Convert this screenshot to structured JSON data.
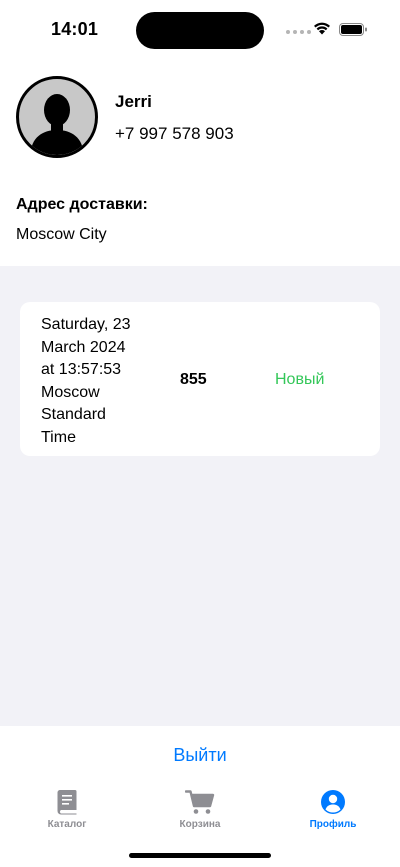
{
  "status_bar": {
    "time": "14:01"
  },
  "profile": {
    "name": "Jerri",
    "phone": "+7  997 578 903"
  },
  "delivery": {
    "label": "Адрес доставки:",
    "value": "Moscow City"
  },
  "orders": [
    {
      "date_lines": [
        "Saturday, 23",
        "March 2024",
        "at 13:57:53",
        "Moscow",
        "Standard",
        "Time"
      ],
      "sum": "855",
      "status": "Новый",
      "status_color": "#34c759"
    }
  ],
  "logout_label": "Выйти",
  "tabs": [
    {
      "label": "Каталог",
      "icon": "book-icon",
      "active": false
    },
    {
      "label": "Корзина",
      "icon": "cart-icon",
      "active": false
    },
    {
      "label": "Профиль",
      "icon": "person-circle-icon",
      "active": true
    }
  ],
  "colors": {
    "accent": "#007aff",
    "status_new": "#34c759",
    "background_grey": "#f2f2f7"
  }
}
